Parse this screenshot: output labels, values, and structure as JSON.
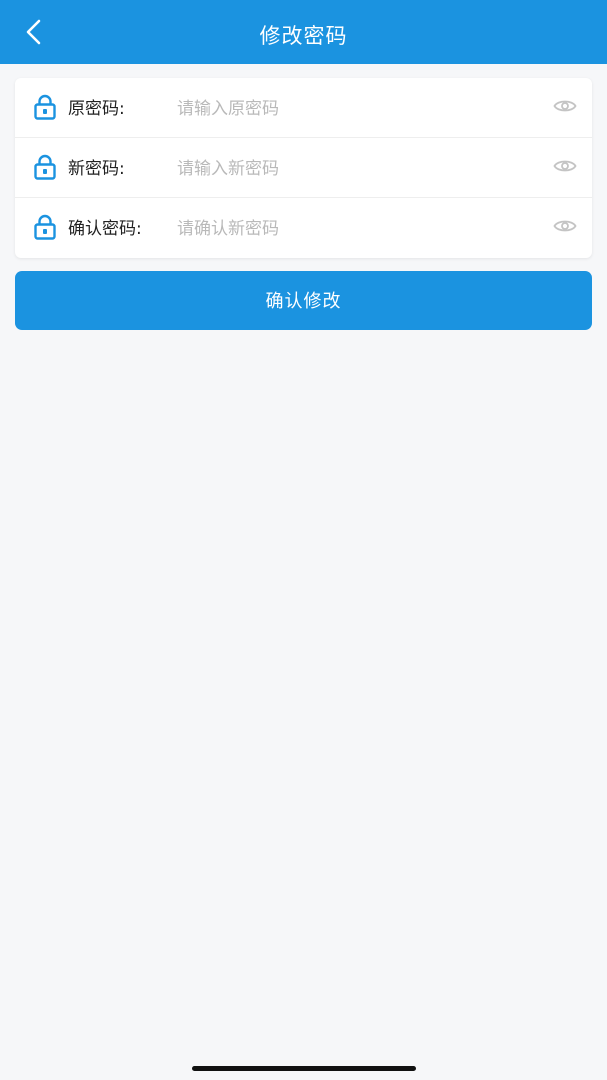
{
  "header": {
    "title": "修改密码",
    "back_icon": "chevron-left-icon"
  },
  "form": {
    "fields": [
      {
        "label": "原密码:",
        "placeholder": "请输入原密码",
        "value": "",
        "lock_icon": "lock-icon",
        "toggle_icon": "eye-icon"
      },
      {
        "label": "新密码:",
        "placeholder": "请输入新密码",
        "value": "",
        "lock_icon": "lock-icon",
        "toggle_icon": "eye-icon"
      },
      {
        "label": "确认密码:",
        "placeholder": "请确认新密码",
        "value": "",
        "lock_icon": "lock-icon",
        "toggle_icon": "eye-icon"
      }
    ]
  },
  "confirm_button": {
    "label": "确认修改"
  },
  "colors": {
    "accent": "#1b93e0",
    "background": "#f6f7f9",
    "placeholder": "#b9b9b9",
    "eye_icon": "#c4c4c4"
  }
}
